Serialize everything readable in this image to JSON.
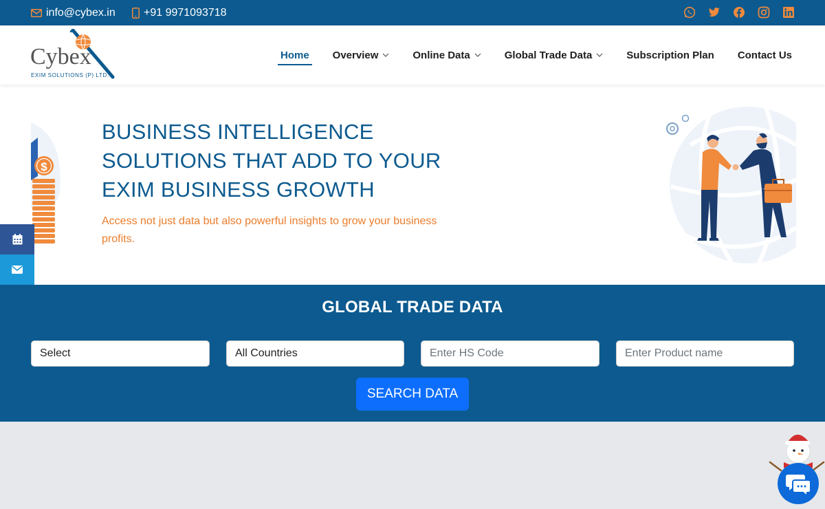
{
  "topbar": {
    "email": "info@cybex.in",
    "phone": "+91 9971093718",
    "socials": [
      "whatsapp-icon",
      "twitter-icon",
      "facebook-icon",
      "instagram-icon",
      "linkedin-icon"
    ]
  },
  "logo": {
    "name": "Cybex",
    "tagline": "EXIM SOLUTIONS (P) LTD."
  },
  "nav": {
    "items": [
      {
        "label": "Home",
        "active": true,
        "dropdown": false
      },
      {
        "label": "Overview",
        "active": false,
        "dropdown": true
      },
      {
        "label": "Online Data",
        "active": false,
        "dropdown": true
      },
      {
        "label": "Global Trade Data",
        "active": false,
        "dropdown": true
      },
      {
        "label": "Subscription Plan",
        "active": false,
        "dropdown": false
      },
      {
        "label": "Contact Us",
        "active": false,
        "dropdown": false
      }
    ]
  },
  "hero": {
    "heading_line1": "BUSINESS INTELLIGENCE",
    "heading_line2": "SOLUTIONS THAT ADD TO YOUR",
    "heading_line3": "EXIM BUSINESS GROWTH",
    "subtext": "Access not just data but also powerful insights to grow your business profits."
  },
  "side_tabs": [
    "calendar-icon",
    "mail-icon"
  ],
  "search": {
    "title": "GLOBAL TRADE DATA",
    "select_value": "Select",
    "country_value": "All Countries",
    "hs_placeholder": "Enter HS Code",
    "product_placeholder": "Enter Product name",
    "button_label": "SEARCH DATA"
  },
  "colors": {
    "brand_blue": "#0c5a8f",
    "accent_orange": "#ea7d2c",
    "button_blue": "#0d6efd"
  }
}
